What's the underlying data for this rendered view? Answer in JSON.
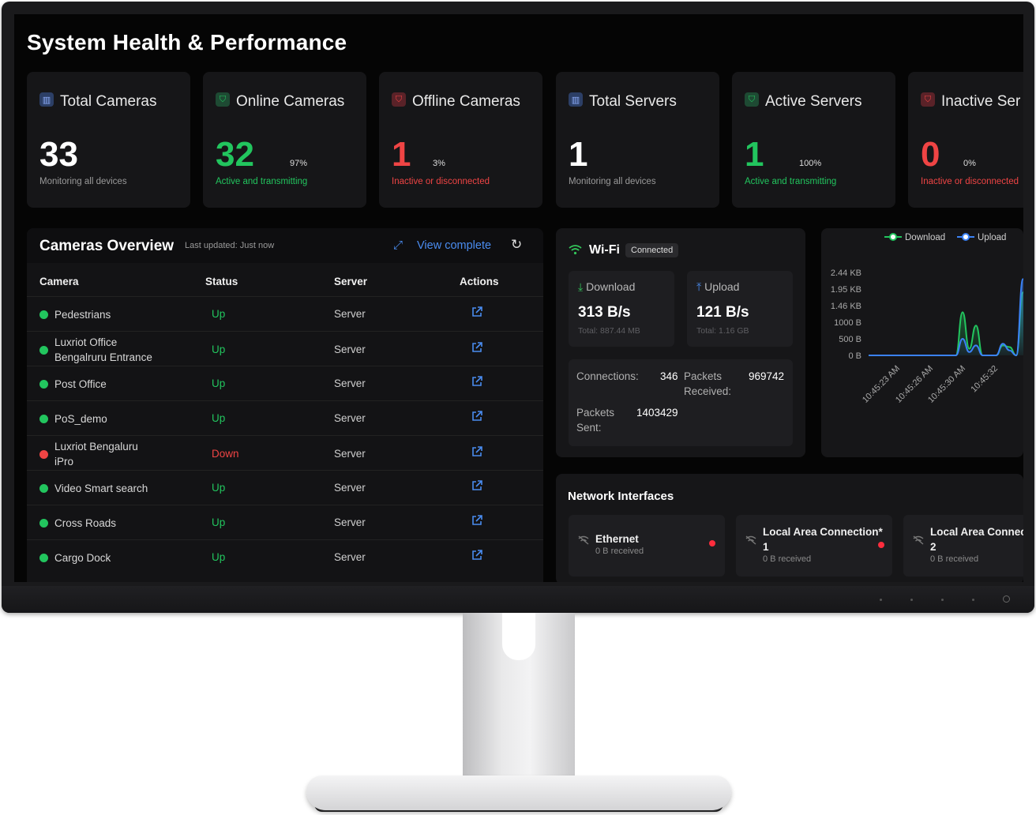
{
  "page_title": "System Health & Performance",
  "colors": {
    "accent_blue": "#4a8cf0",
    "green": "#22c55e",
    "red": "#ef4444",
    "panel_bg": "#161618",
    "screen_bg": "#050505"
  },
  "stats": [
    {
      "label": "Total Cameras",
      "value": "33",
      "pct": "",
      "sub": "Monitoring all devices",
      "tone": "neutral",
      "icon": "bar-chart-icon"
    },
    {
      "label": "Online Cameras",
      "value": "32",
      "pct": "97%",
      "sub": "Active and transmitting",
      "tone": "green",
      "icon": "shield-check-icon"
    },
    {
      "label": "Offline Cameras",
      "value": "1",
      "pct": "3%",
      "sub": "Inactive or disconnected",
      "tone": "red",
      "icon": "shield-alert-icon"
    },
    {
      "label": "Total Servers",
      "value": "1",
      "pct": "",
      "sub": "Monitoring all devices",
      "tone": "neutral",
      "icon": "bar-chart-icon"
    },
    {
      "label": "Active Servers",
      "value": "1",
      "pct": "100%",
      "sub": "Active and transmitting",
      "tone": "green",
      "icon": "shield-check-icon"
    },
    {
      "label": "Inactive Ser",
      "value": "0",
      "pct": "0%",
      "sub": "Inactive or disconnected",
      "tone": "red",
      "icon": "shield-alert-icon"
    }
  ],
  "cameras": {
    "title": "Cameras Overview",
    "last_updated": "Last updated: Just now",
    "view_complete": "View complete",
    "columns": [
      "Camera",
      "Status",
      "Server",
      "Actions"
    ],
    "rows": [
      {
        "name": [
          "Pedestrians"
        ],
        "status": "Up",
        "server": "Server"
      },
      {
        "name": [
          "Luxriot Office",
          "Bengalruru Entrance"
        ],
        "status": "Up",
        "server": "Server"
      },
      {
        "name": [
          "Post Office"
        ],
        "status": "Up",
        "server": "Server"
      },
      {
        "name": [
          "PoS_demo"
        ],
        "status": "Up",
        "server": "Server"
      },
      {
        "name": [
          "Luxriot Bengaluru",
          "iPro"
        ],
        "status": "Down",
        "server": "Server"
      },
      {
        "name": [
          "Video Smart search"
        ],
        "status": "Up",
        "server": "Server"
      },
      {
        "name": [
          "Cross Roads"
        ],
        "status": "Up",
        "server": "Server"
      },
      {
        "name": [
          "Cargo Dock"
        ],
        "status": "Up",
        "server": "Server"
      }
    ]
  },
  "wifi": {
    "title": "Wi-Fi",
    "badge": "Connected",
    "download": {
      "label": "Download",
      "value": "313 B/s",
      "total": "Total: 887.44 MB"
    },
    "upload": {
      "label": "Upload",
      "value": "121 B/s",
      "total": "Total: 1.16 GB"
    },
    "connections_label": "Connections:",
    "connections_value": "346",
    "packets_received_label": [
      "Packets",
      "Received:"
    ],
    "packets_received_value": "969742",
    "packets_sent_label": [
      "Packets",
      "Sent:"
    ],
    "packets_sent_value": "1403429"
  },
  "chart_data": {
    "type": "area",
    "legend": [
      "Download",
      "Upload"
    ],
    "legend_position": "top",
    "y_ticks": [
      "2.44 KB",
      "1.95 KB",
      "1.46 KB",
      "1000 B",
      "500 B",
      "0 B"
    ],
    "x_ticks": [
      "10:45:23 AM",
      "10:45:26 AM",
      "10:45:30 AM",
      "10:45:32"
    ],
    "ylim_bytes": [
      0,
      2500
    ],
    "series": [
      {
        "name": "Download",
        "color": "#22c55e",
        "values": [
          0,
          0,
          0,
          0,
          0,
          0,
          0,
          0,
          0,
          0,
          0,
          0,
          0,
          0,
          1300,
          200,
          900,
          0,
          0,
          0,
          300,
          250,
          0,
          1900,
          400
        ]
      },
      {
        "name": "Upload",
        "color": "#3b82f6",
        "values": [
          0,
          0,
          0,
          0,
          0,
          0,
          0,
          0,
          0,
          0,
          0,
          0,
          0,
          0,
          500,
          100,
          300,
          0,
          0,
          0,
          350,
          150,
          0,
          2300,
          900
        ]
      }
    ]
  },
  "network": {
    "title": "Network Interfaces",
    "interfaces": [
      {
        "name": [
          "Ethernet"
        ],
        "sub": "0 B received"
      },
      {
        "name": [
          "Local Area Connection*",
          "1"
        ],
        "sub": "0 B received"
      },
      {
        "name": [
          "Local Area Connecti",
          "2"
        ],
        "sub": "0 B received"
      }
    ]
  }
}
